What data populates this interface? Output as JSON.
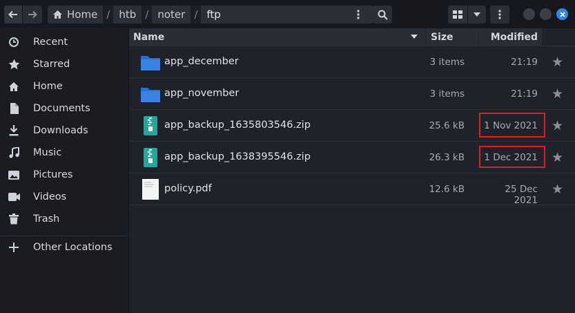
{
  "header": {
    "breadcrumbs": [
      "Home",
      "htb",
      "noter",
      "ftp"
    ],
    "separator": "/"
  },
  "sidebar": {
    "items": [
      {
        "label": "Recent",
        "icon": "clock-icon"
      },
      {
        "label": "Starred",
        "icon": "star-icon"
      },
      {
        "label": "Home",
        "icon": "home-icon"
      },
      {
        "label": "Documents",
        "icon": "document-icon"
      },
      {
        "label": "Downloads",
        "icon": "download-icon"
      },
      {
        "label": "Music",
        "icon": "music-icon"
      },
      {
        "label": "Pictures",
        "icon": "picture-icon"
      },
      {
        "label": "Videos",
        "icon": "video-icon"
      },
      {
        "label": "Trash",
        "icon": "trash-icon"
      }
    ],
    "other": {
      "label": "Other Locations",
      "icon": "plus-icon"
    }
  },
  "columns": {
    "name": "Name",
    "size": "Size",
    "modified": "Modified"
  },
  "files": [
    {
      "name": "app_december",
      "size": "3 items",
      "modified": "21:19",
      "type": "folder"
    },
    {
      "name": "app_november",
      "size": "3 items",
      "modified": "21:19",
      "type": "folder"
    },
    {
      "name": "app_backup_1635803546.zip",
      "size": "25.6 kB",
      "modified": "1 Nov 2021",
      "type": "zip"
    },
    {
      "name": "app_backup_1638395546.zip",
      "size": "26.3 kB",
      "modified": "1 Dec 2021",
      "type": "zip"
    },
    {
      "name": "policy.pdf",
      "size": "12.6 kB",
      "modified": "25 Dec 2021",
      "type": "pdf"
    }
  ],
  "colors": {
    "accent": "#3584e4",
    "folder": "#3b82e6",
    "zip": "#27a59b",
    "highlight": "#e01e26"
  }
}
